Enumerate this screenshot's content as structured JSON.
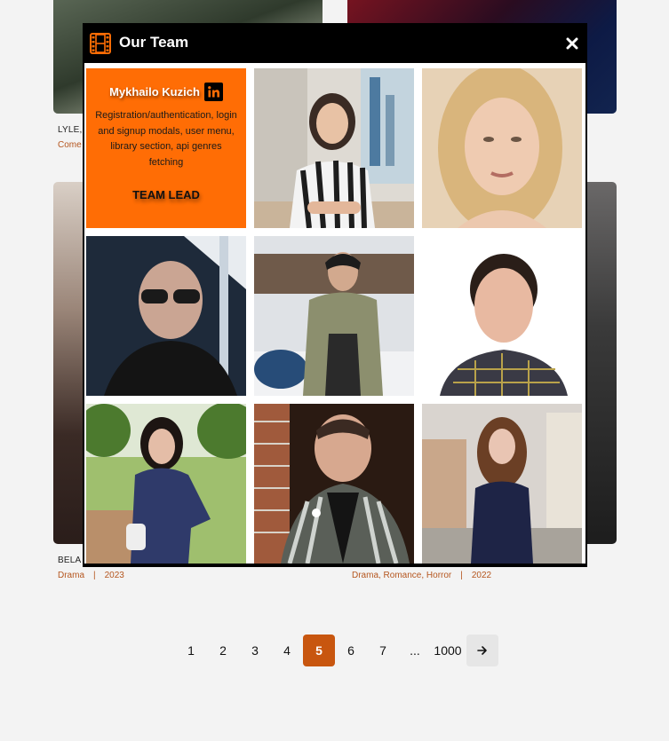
{
  "background_cards": [
    {
      "title": "LYLE,",
      "meta": {
        "genres": "Come",
        "year": ""
      }
    },
    {
      "title": "",
      "meta": {
        "genres": "",
        "year": ""
      }
    },
    {
      "title": "BELA",
      "meta": {
        "genres": "Drama",
        "year": "2023"
      }
    },
    {
      "title": "",
      "meta": {
        "genres": "Drama, Romance, Horror",
        "year": "2022"
      }
    }
  ],
  "pagination": {
    "pages": [
      "1",
      "2",
      "3",
      "4",
      "5",
      "6",
      "7",
      "...",
      "1000"
    ],
    "current": "5",
    "next_icon": "arrow-right-icon"
  },
  "modal": {
    "title": "Our Team",
    "title_icon": "film-icon",
    "close_icon": "close-icon",
    "lead": {
      "name": "Mykhailo Kuzich",
      "social_icon": "linkedin-icon",
      "description": "Registration/authentication, login and signup modals, user menu, library section, api genres fetching",
      "role": "TEAM LEAD"
    },
    "members": [
      {
        "id": "member-2"
      },
      {
        "id": "member-3"
      },
      {
        "id": "member-4"
      },
      {
        "id": "member-5"
      },
      {
        "id": "member-6"
      },
      {
        "id": "member-7"
      },
      {
        "id": "member-8"
      },
      {
        "id": "member-9"
      }
    ]
  },
  "colors": {
    "accent": "#ff6d05",
    "active_page": "#c8560f",
    "meta_text": "#b5561f",
    "modal_bg": "#000000"
  }
}
